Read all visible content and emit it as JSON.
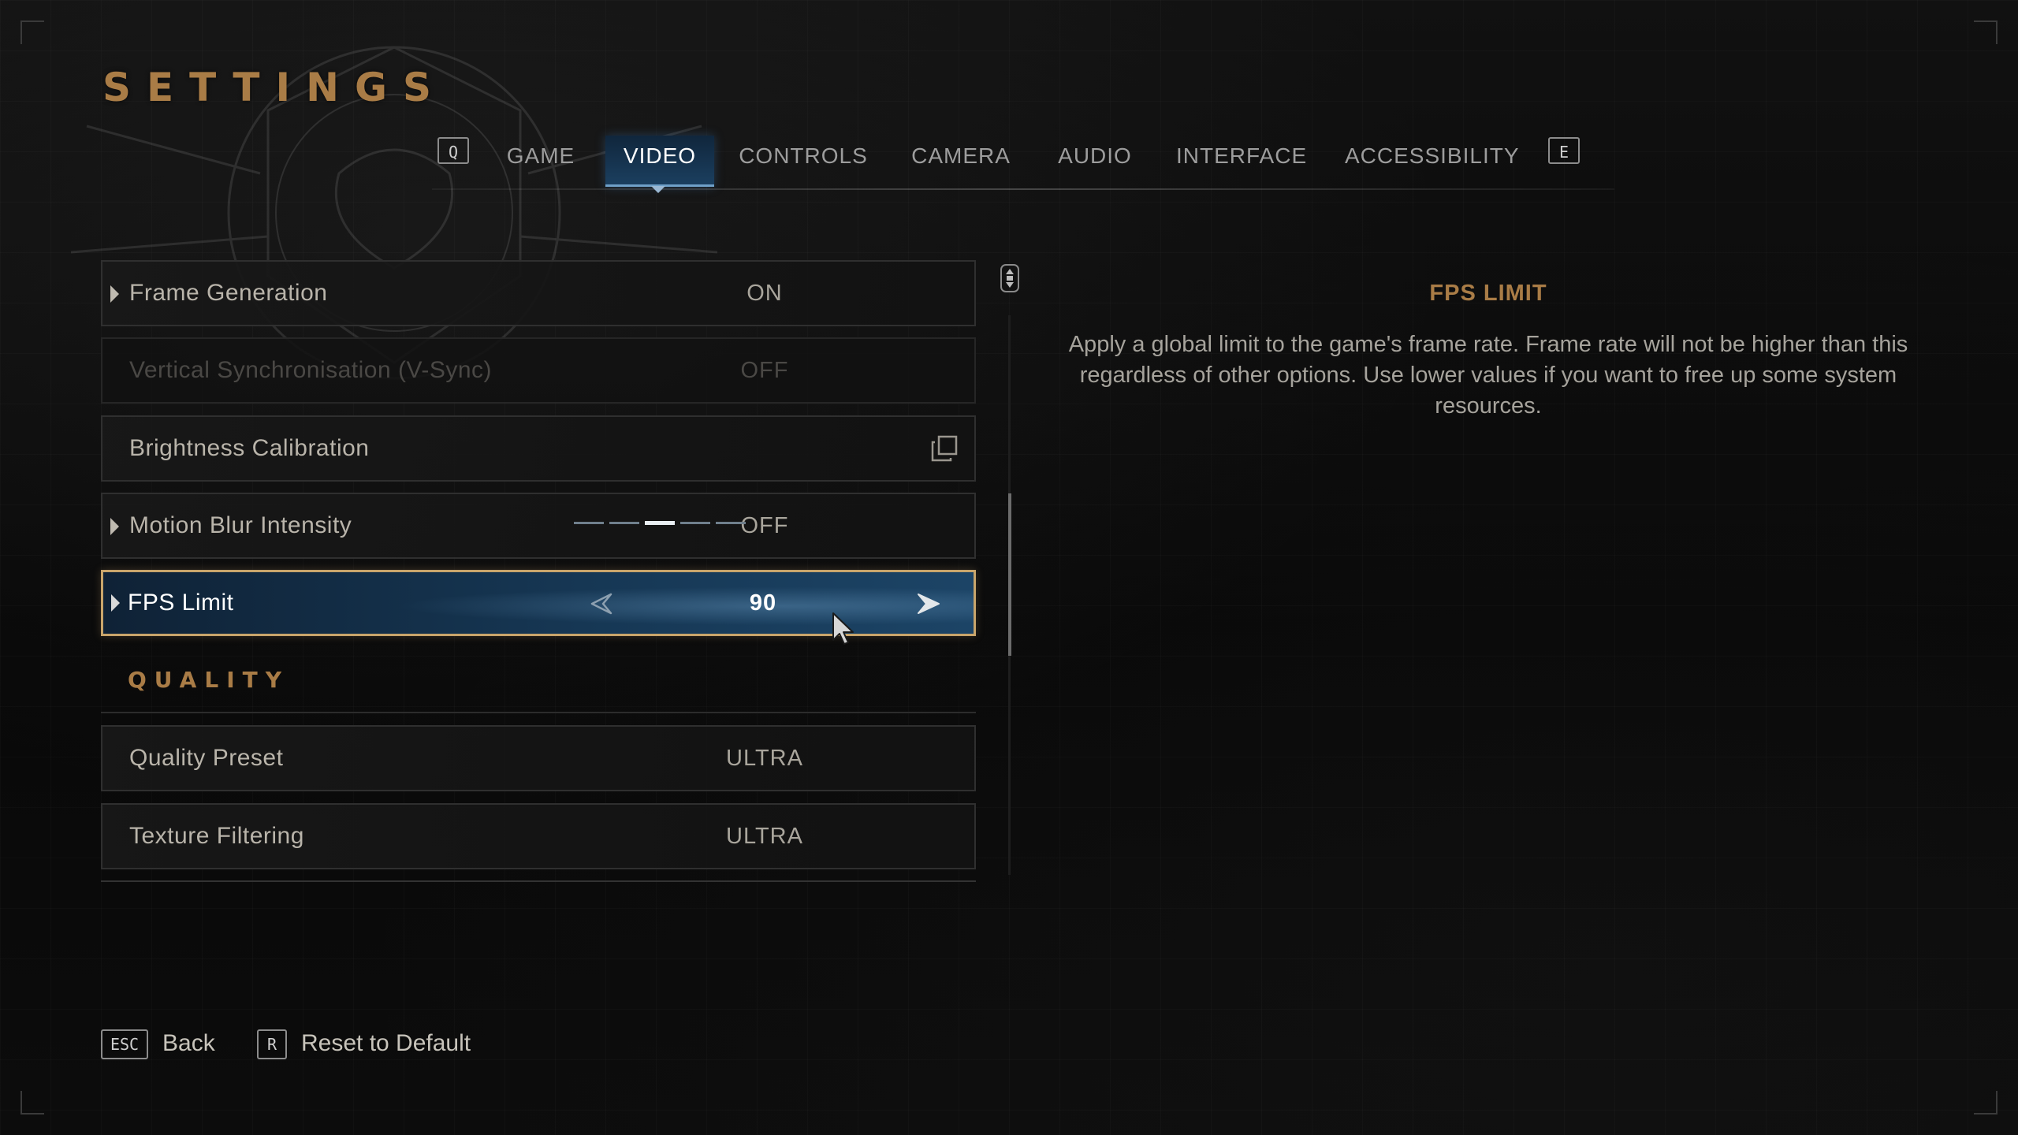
{
  "page": {
    "title": "SETTINGS"
  },
  "tabs": {
    "prev_key": "Q",
    "next_key": "E",
    "active": "VIDEO",
    "items": [
      {
        "label": "GAME"
      },
      {
        "label": "VIDEO"
      },
      {
        "label": "CONTROLS"
      },
      {
        "label": "CAMERA"
      },
      {
        "label": "AUDIO"
      },
      {
        "label": "INTERFACE"
      },
      {
        "label": "ACCESSIBILITY"
      }
    ]
  },
  "settings": {
    "rows": [
      {
        "label": "Frame Generation",
        "value": "ON",
        "state": "normal",
        "expandable": true
      },
      {
        "label": "Vertical Synchronisation (V-Sync)",
        "value": "OFF",
        "state": "disabled",
        "expandable": false
      },
      {
        "label": "Brightness Calibration",
        "value": "",
        "state": "normal",
        "expandable": false,
        "icon": "open-window-icon"
      },
      {
        "label": "Motion Blur Intensity",
        "value": "OFF",
        "state": "normal",
        "expandable": true
      },
      {
        "label": "FPS Limit",
        "value": "90",
        "state": "selected",
        "expandable": true,
        "step_count": 5,
        "selected_step": 3
      }
    ],
    "quality": {
      "header": "QUALITY",
      "rows": [
        {
          "label": "Quality Preset",
          "value": "ULTRA"
        },
        {
          "label": "Texture Filtering",
          "value": "ULTRA"
        }
      ]
    }
  },
  "detail": {
    "title": "FPS LIMIT",
    "body": "Apply a global limit to the game's frame rate. Frame rate will not be higher than this regardless of other options. Use lower values if you want to free up some system resources."
  },
  "footer": {
    "back": {
      "key": "ESC",
      "label": "Back"
    },
    "reset": {
      "key": "R",
      "label": "Reset to Default"
    }
  },
  "colors": {
    "accent_gold": "#a97c46",
    "selected_border": "#c9a56b",
    "selected_fill": "#163754",
    "text": "#b9b4aa"
  }
}
